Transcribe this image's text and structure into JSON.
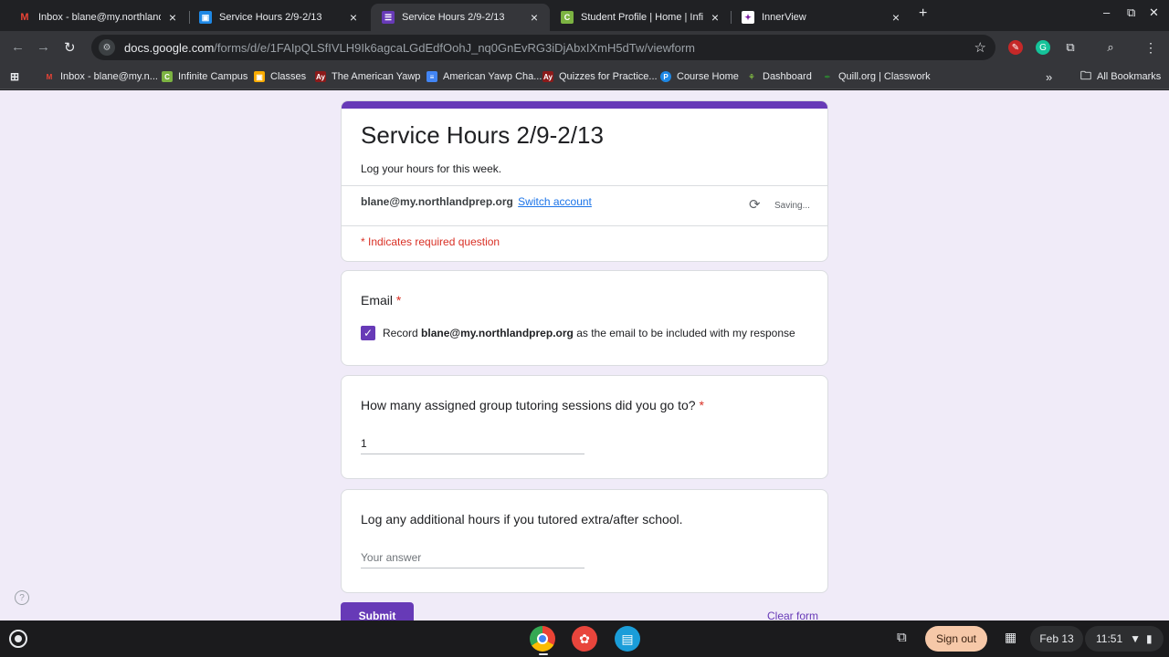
{
  "browser": {
    "tabs": [
      {
        "title": "Inbox - blane@my.northlandprep",
        "favicon": "gmail-icon",
        "active": false
      },
      {
        "title": "Service Hours 2/9-2/13",
        "favicon": "classroom-icon",
        "active": false
      },
      {
        "title": "Service Hours 2/9-2/13",
        "favicon": "forms-icon",
        "active": true
      },
      {
        "title": "Student Profile | Home | Infinite",
        "favicon": "infinite-campus-icon",
        "active": false
      },
      {
        "title": "InnerView",
        "favicon": "innerview-icon",
        "active": false
      }
    ],
    "url": {
      "host": "docs.google.com",
      "path": "/forms/d/e/1FAIpQLSfIVLH9Ik6agcaLGdEdfOohJ_nq0GnEvRG3iDjAbxIXmH5dTw/viewform"
    },
    "bookmarks": [
      {
        "label": "Inbox - blane@my.n..."
      },
      {
        "label": "Infinite Campus"
      },
      {
        "label": "Classes"
      },
      {
        "label": "The American Yawp"
      },
      {
        "label": "American Yawp Cha..."
      },
      {
        "label": "Quizzes for Practice..."
      },
      {
        "label": "Course Home"
      },
      {
        "label": "Dashboard"
      },
      {
        "label": "Quill.org | Classwork"
      }
    ],
    "all_bookmarks": "All Bookmarks",
    "overflow": "»"
  },
  "form": {
    "title": "Service Hours 2/9-2/13",
    "description": "Log your hours for this week.",
    "account_email": "blane@my.northlandprep.org",
    "switch_account": "Switch account",
    "saving": "Saving...",
    "required_note": "* Indicates required question",
    "email_question": {
      "label": "Email",
      "required_mark": "*",
      "checkbox_prefix": "Record",
      "checkbox_email": "blane@my.northlandprep.org",
      "checkbox_suffix": "as the email to be included with my response",
      "checked": true
    },
    "q1": {
      "label": "How many assigned group tutoring sessions did you go to?",
      "required_mark": "*",
      "value": "1"
    },
    "q2": {
      "label": "Log any additional hours if you tutored extra/after school.",
      "placeholder": "Your answer",
      "value": ""
    },
    "submit_label": "Submit",
    "clear_label": "Clear form",
    "accent_color": "#673ab7"
  },
  "shelf": {
    "sign_out": "Sign out",
    "date": "Feb 13",
    "time": "11:51"
  }
}
